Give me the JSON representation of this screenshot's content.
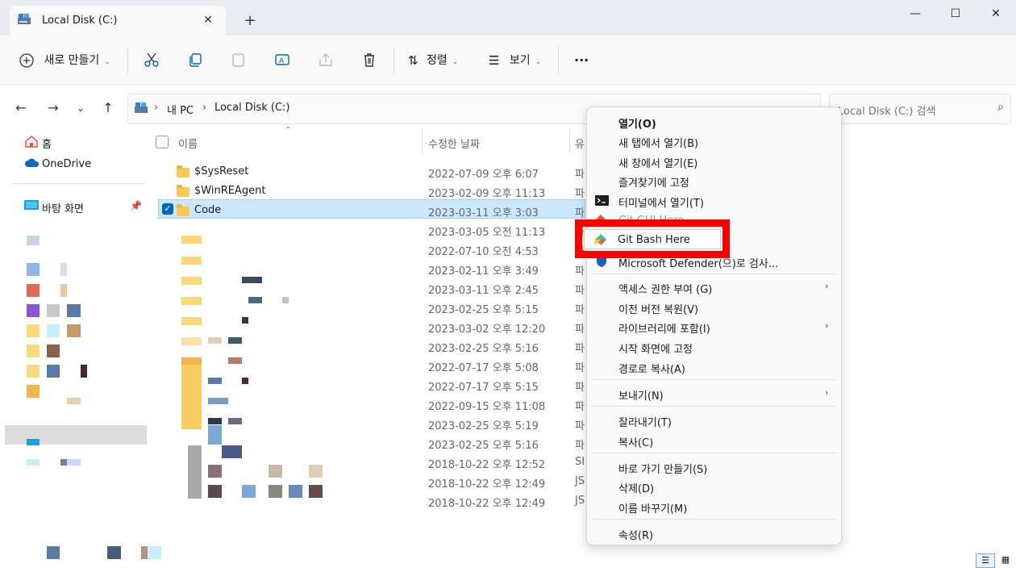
{
  "window": {
    "tab_title": "Local Disk (C:)",
    "new_tab": "+",
    "minimize": "—",
    "maximize": "☐",
    "close": "✕"
  },
  "toolbar": {
    "new_label": "새로 만들기",
    "sort_label": "정렬",
    "view_label": "보기",
    "more_label": "···"
  },
  "address": {
    "crumbs": [
      "내 PC",
      "Local Disk (C:)"
    ],
    "search_placeholder": "Local Disk (C:) 검색"
  },
  "sidebar": {
    "items": [
      {
        "label": "홈",
        "icon": "home-icon"
      },
      {
        "label": "OneDrive",
        "icon": "cloud-icon"
      },
      {
        "label": "바탕 화면",
        "icon": "desktop-icon"
      }
    ]
  },
  "columns": {
    "name": "이름",
    "date": "수정한 날짜",
    "type": "유"
  },
  "files": [
    {
      "name": "$SysReset",
      "date": "2022-07-09 오후 6:07",
      "type": "파"
    },
    {
      "name": "$WinREAgent",
      "date": "2023-02-09 오후 11:13",
      "type": "파"
    },
    {
      "name": "Code",
      "date": "2023-03-11 오후 3:03",
      "type": "파",
      "selected": true
    },
    {
      "name": "",
      "date": "2023-03-05 오전 11:13",
      "type": "파"
    },
    {
      "name": "",
      "date": "2022-07-10 오전 4:53",
      "type": "파"
    },
    {
      "name": "",
      "date": "2023-02-11 오후 3:49",
      "type": "파"
    },
    {
      "name": "",
      "date": "2023-03-11 오후 2:45",
      "type": "파"
    },
    {
      "name": "",
      "date": "2023-02-25 오후 5:15",
      "type": "파"
    },
    {
      "name": "",
      "date": "2023-03-02 오후 12:20",
      "type": "파"
    },
    {
      "name": "",
      "date": "2023-02-25 오후 5:16",
      "type": "파"
    },
    {
      "name": "",
      "date": "2022-07-17 오후 5:08",
      "type": "파"
    },
    {
      "name": "",
      "date": "2022-07-17 오후 5:15",
      "type": "파"
    },
    {
      "name": "",
      "date": "2022-09-15 오후 11:08",
      "type": "파"
    },
    {
      "name": "",
      "date": "2023-02-25 오후 5:19",
      "type": "파"
    },
    {
      "name": "",
      "date": "2023-02-25 오후 5:16",
      "type": "파"
    },
    {
      "name": "",
      "date": "2018-10-22 오후 12:52",
      "type": "SI"
    },
    {
      "name": "",
      "date": "2018-10-22 오후 12:49",
      "type": "JS"
    },
    {
      "name": "",
      "date": "2018-10-22 오후 12:49",
      "type": "JS"
    }
  ],
  "context_menu": {
    "open": "열기(O)",
    "open_new_tab": "새 탭에서 열기(B)",
    "open_new_window": "새 창에서 열기(E)",
    "pin_favorites": "즐겨찾기에 고정",
    "open_terminal": "터미널에서 열기(T)",
    "git_gui": "Git GUI Here",
    "git_bash": "Git Bash Here",
    "defender": "Microsoft Defender(으)로 검사...",
    "give_access": "액세스 권한 부여 (G)",
    "restore_prev": "이전 버전 복원(V)",
    "include_library": "라이브러리에 포함(I)",
    "pin_start": "시작 화면에 고정",
    "copy_path": "경로로 복사(A)",
    "send_to": "보내기(N)",
    "cut": "잘라내기(T)",
    "copy": "복사(C)",
    "create_shortcut": "바로 가기 만들기(S)",
    "delete": "삭제(D)",
    "rename": "이름 바꾸기(M)",
    "properties": "속성(R)"
  },
  "colors": {
    "highlight": "#ff0000",
    "selection": "#cce8ff",
    "accent": "#0067c0"
  }
}
